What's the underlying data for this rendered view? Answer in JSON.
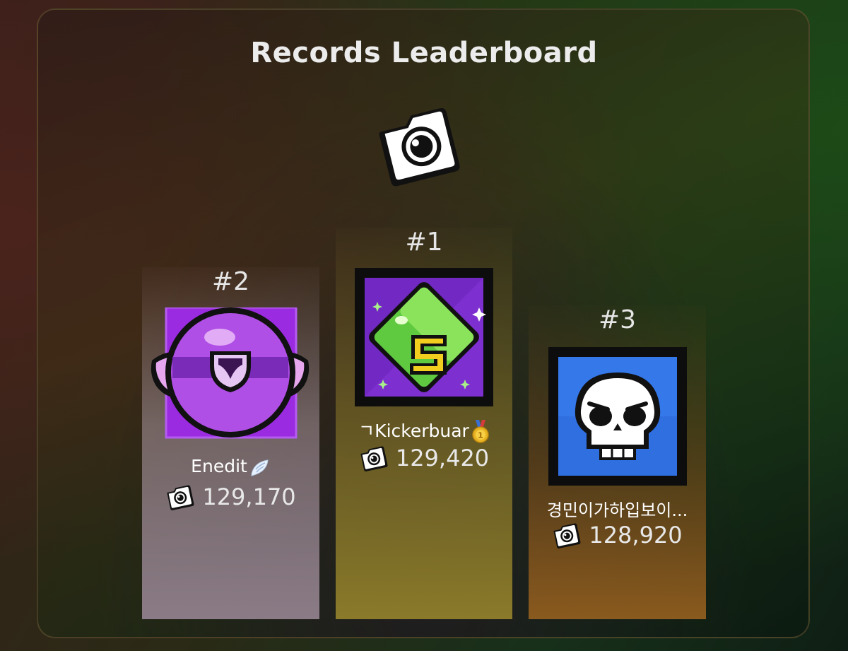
{
  "leaderboard": {
    "title": "Records Leaderboard",
    "trophy_icon": "camera-records-icon",
    "entries": [
      {
        "rank": "#1",
        "name": "ㄱKickerbuar",
        "badge_icon": "gold-medal-icon",
        "score": "129,420",
        "avatar_icon": "green-s-cube-icon"
      },
      {
        "rank": "#2",
        "name": "Enedit",
        "badge_icon": "angel-wing-icon",
        "score": "129,170",
        "avatar_icon": "purple-orb-winged-icon"
      },
      {
        "rank": "#3",
        "name": "경민이가하입보이...",
        "score": "128,920",
        "avatar_icon": "skull-icon"
      }
    ],
    "colors": {
      "first": "#8a7a2a",
      "second": "#8b7b86",
      "third": "#8a5a1e"
    }
  }
}
